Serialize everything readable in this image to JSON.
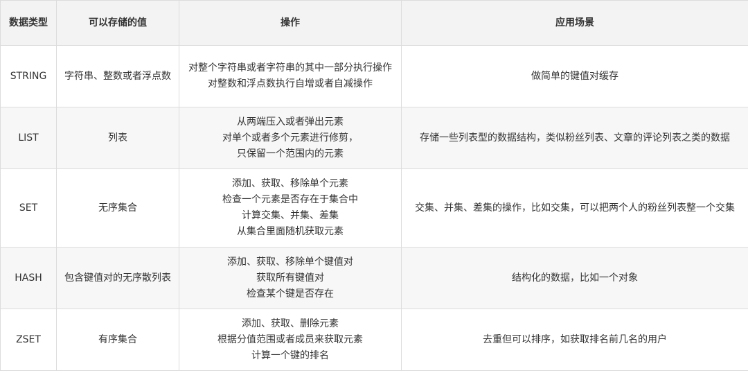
{
  "headers": [
    "数据类型",
    "可以存储的值",
    "操作",
    "应用场景"
  ],
  "rows": [
    {
      "type": "STRING",
      "value": "字符串、整数或者浮点数",
      "ops": [
        "对整个字符串或者字符串的其中一部分执行操作",
        "对整数和浮点数执行自增或者自减操作"
      ],
      "usage": "做简单的键值对缓存"
    },
    {
      "type": "LIST",
      "value": "列表",
      "ops": [
        "从两端压入或者弹出元素",
        "对单个或者多个元素进行修剪，",
        "只保留一个范围内的元素"
      ],
      "usage": "存储一些列表型的数据结构，类似粉丝列表、文章的评论列表之类的数据"
    },
    {
      "type": "SET",
      "value": "无序集合",
      "ops": [
        "添加、获取、移除单个元素",
        "检查一个元素是否存在于集合中",
        "计算交集、并集、差集",
        "从集合里面随机获取元素"
      ],
      "usage": "交集、并集、差集的操作，比如交集，可以把两个人的粉丝列表整一个交集"
    },
    {
      "type": "HASH",
      "value": "包含键值对的无序散列表",
      "ops": [
        "添加、获取、移除单个键值对",
        "获取所有键值对",
        "检查某个键是否存在"
      ],
      "usage": "结构化的数据，比如一个对象"
    },
    {
      "type": "ZSET",
      "value": "有序集合",
      "ops": [
        "添加、获取、删除元素",
        "根据分值范围或者成员来获取元素",
        "计算一个键的排名"
      ],
      "usage": "去重但可以排序，如获取排名前几名的用户"
    }
  ]
}
